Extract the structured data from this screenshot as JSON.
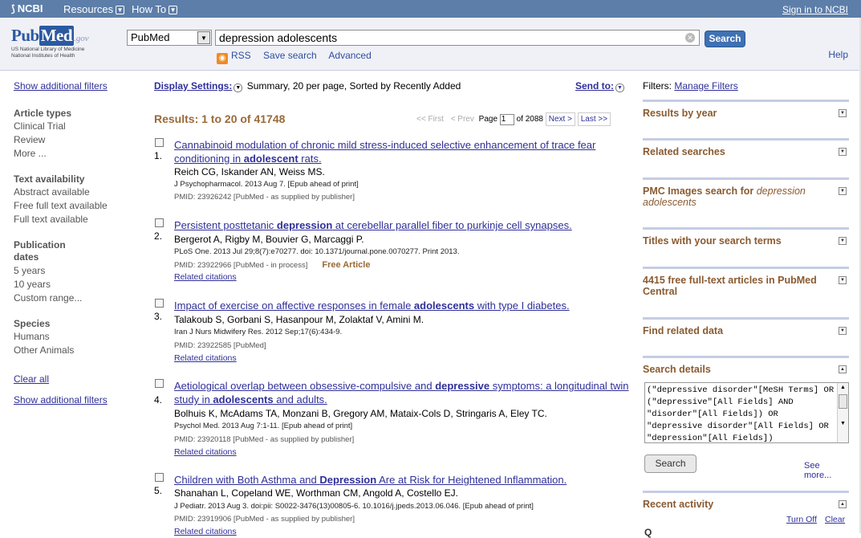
{
  "topbar": {
    "ncbi": "NCBI",
    "resources": "Resources",
    "howto": "How To",
    "signin": "Sign in to NCBI"
  },
  "logo": {
    "pub": "Pub",
    "med": "Med",
    "gov": ".gov",
    "sub1": "US National Library of Medicine",
    "sub2": "National Institutes of Health"
  },
  "search": {
    "database": "PubMed",
    "query": "depression adolescents",
    "button": "Search",
    "rss": "RSS",
    "save": "Save search",
    "advanced": "Advanced",
    "help": "Help"
  },
  "left": {
    "show_filters_top": "Show additional filters",
    "groups": [
      {
        "title": "Article types",
        "items": [
          "Clinical Trial",
          "Review",
          "More ..."
        ]
      },
      {
        "title": "Text availability",
        "items": [
          "Abstract available",
          "Free full text available",
          "Full text available"
        ]
      },
      {
        "title": "Publication dates",
        "items": [
          "5 years",
          "10 years",
          "Custom range..."
        ]
      },
      {
        "title": "Species",
        "items": [
          "Humans",
          "Other Animals"
        ]
      }
    ],
    "clear_all": "Clear all",
    "show_filters_bottom": "Show additional filters"
  },
  "display": {
    "label": "Display Settings:",
    "summary": "Summary, 20 per page, Sorted by Recently Added",
    "sendto": "Send to:"
  },
  "results": {
    "summary": "Results: 1 to 20 of 41748",
    "first": "<< First",
    "prev": "< Prev",
    "page_label": "Page",
    "page": "1",
    "of": "of 2088",
    "next": "Next >",
    "last": "Last >>",
    "items": [
      {
        "num": "1.",
        "title_parts": [
          {
            "t": "Cannabinoid modulation of chronic mild stress-induced selective enhancement of trace fear conditioning in ",
            "b": false
          },
          {
            "t": "adolescent",
            "b": true
          },
          {
            "t": " rats.",
            "b": false
          }
        ],
        "authors": "Reich CG, Iskander AN, Weiss MS.",
        "journal": "J Psychopharmacol. 2013 Aug 7. [Epub ahead of print]",
        "pmid": "PMID: 23926242 [PubMed - as supplied by publisher]",
        "free": "",
        "related": ""
      },
      {
        "num": "2.",
        "title_parts": [
          {
            "t": "Persistent posttetanic ",
            "b": false
          },
          {
            "t": "depression",
            "b": true
          },
          {
            "t": " at cerebellar parallel fiber to purkinje cell synapses.",
            "b": false
          }
        ],
        "authors": "Bergerot A, Rigby M, Bouvier G, Marcaggi P.",
        "journal": "PLoS One. 2013 Jul 29;8(7):e70277. doi: 10.1371/journal.pone.0070277. Print 2013.",
        "pmid": "PMID: 23922966 [PubMed - in process]",
        "free": "Free Article",
        "related": "Related citations"
      },
      {
        "num": "3.",
        "title_parts": [
          {
            "t": "Impact of exercise on affective responses in female ",
            "b": false
          },
          {
            "t": "adolescents",
            "b": true
          },
          {
            "t": " with type I diabetes.",
            "b": false
          }
        ],
        "authors": "Talakoub S, Gorbani S, Hasanpour M, Zolaktaf V, Amini M.",
        "journal": "Iran J Nurs Midwifery Res. 2012 Sep;17(6):434-9.",
        "pmid": "PMID: 23922585 [PubMed]",
        "free": "",
        "related": "Related citations"
      },
      {
        "num": "4.",
        "title_parts": [
          {
            "t": "Aetiological overlap between obsessive-compulsive and ",
            "b": false
          },
          {
            "t": "depressive",
            "b": true
          },
          {
            "t": " symptoms: a longitudinal twin study in ",
            "b": false
          },
          {
            "t": "adolescents",
            "b": true
          },
          {
            "t": " and adults.",
            "b": false
          }
        ],
        "authors": "Bolhuis K, McAdams TA, Monzani B, Gregory AM, Mataix-Cols D, Stringaris A, Eley TC.",
        "journal": "Psychol Med. 2013 Aug 7:1-11. [Epub ahead of print]",
        "pmid": "PMID: 23920118 [PubMed - as supplied by publisher]",
        "free": "",
        "related": "Related citations"
      },
      {
        "num": "5.",
        "title_parts": [
          {
            "t": "Children with Both Asthma and ",
            "b": false
          },
          {
            "t": "Depression",
            "b": true
          },
          {
            "t": " Are at Risk for Heightened Inflammation.",
            "b": false
          }
        ],
        "authors": "Shanahan L, Copeland WE, Worthman CM, Angold A, Costello EJ.",
        "journal": "J Pediatr. 2013 Aug 3. doi:pii: S0022-3476(13)00805-6. 10.1016/j.jpeds.2013.06.046. [Epub ahead of print]",
        "pmid": "PMID: 23919906 [PubMed - as supplied by publisher]",
        "free": "",
        "related": "Related citations"
      }
    ]
  },
  "right": {
    "filters_label": "Filters:",
    "manage_filters": "Manage Filters",
    "panels": [
      {
        "title": "Results by year",
        "italic": ""
      },
      {
        "title": "Related searches",
        "italic": ""
      },
      {
        "title": "PMC Images search for ",
        "italic": "depression adolescents"
      },
      {
        "title": "Titles with your search terms",
        "italic": ""
      },
      {
        "title": "4415 free full-text articles in PubMed Central",
        "italic": ""
      },
      {
        "title": "Find related data",
        "italic": ""
      },
      {
        "title": "Search details",
        "italic": ""
      },
      {
        "title": "Recent activity",
        "italic": ""
      }
    ],
    "search_details_text": "(\"depressive disorder\"[MeSH Terms] OR (\"depressive\"[All Fields] AND \"disorder\"[All Fields]) OR \"depressive disorder\"[All Fields] OR \"depression\"[All Fields])",
    "search_button": "Search",
    "see_more": "See more...",
    "turn_off": "Turn Off",
    "clear": "Clear",
    "recent_stub": "Q"
  }
}
